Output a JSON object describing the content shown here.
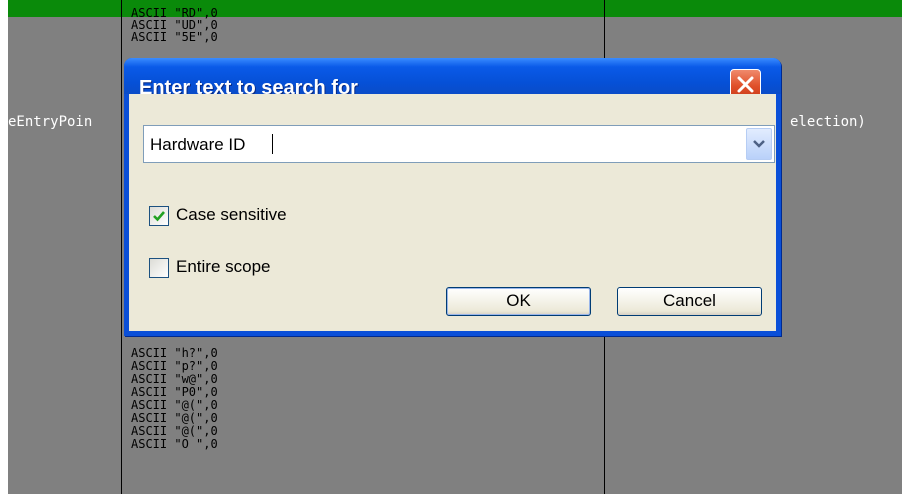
{
  "background": {
    "colors": {
      "panel": "#808080",
      "highlight_bar": "#0a8a0a"
    },
    "code_lines_top": [
      "ASCII \"RD\",0",
      "ASCII \"UD\",0",
      "ASCII \"5E\",0"
    ],
    "code_lines_bottom": [
      "ASCII \"h?\",0",
      "ASCII \"p?\",0",
      "ASCII \"w@\",0",
      "ASCII \"P0\",0",
      "ASCII \"@(\",0",
      "ASCII \"@(\",0",
      "ASCII \"@(\",0",
      "ASCII \"O \",0"
    ],
    "left_fragment": "eEntryPoin",
    "right_fragment": "election)"
  },
  "dialog": {
    "title": "Enter text to search for",
    "close_icon": "close-icon",
    "search_value": "Hardware ID",
    "dropdown_icon": "chevron-down-icon",
    "options": {
      "case_sensitive": {
        "label": "Case sensitive",
        "checked": true
      },
      "entire_scope": {
        "label": "Entire scope",
        "checked": false
      }
    },
    "buttons": {
      "ok": "OK",
      "cancel": "Cancel"
    },
    "colors": {
      "titlebar": "#0a5ae8",
      "client": "#ece9d8",
      "close": "#e0502a"
    }
  }
}
